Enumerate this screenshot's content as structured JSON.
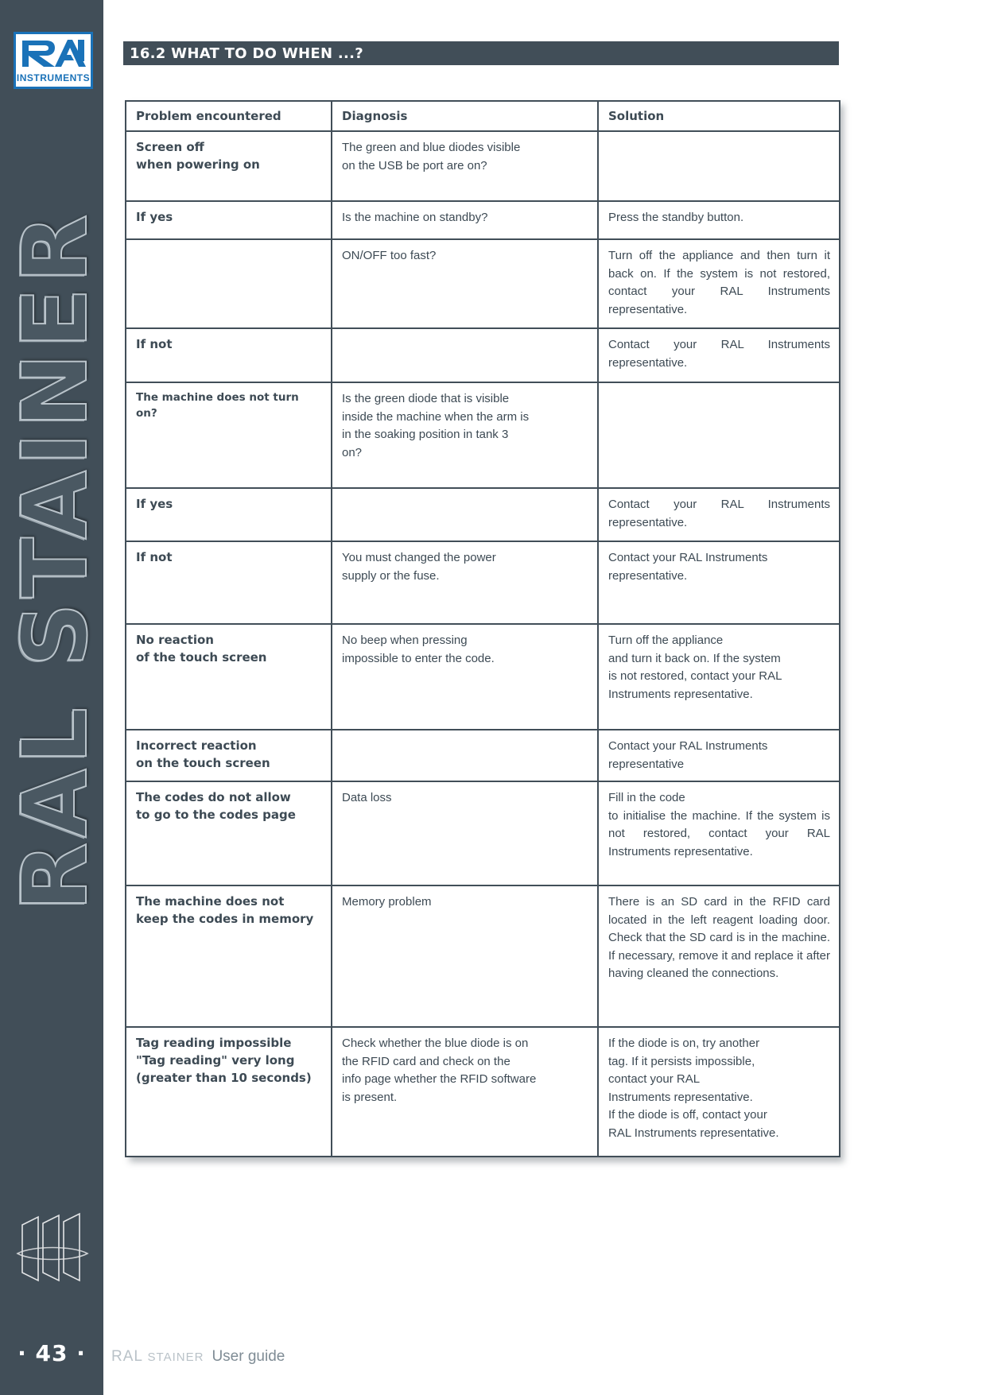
{
  "sidebar": {
    "logo": {
      "mark": "RAL",
      "wordmark": "INSTRUMENTS"
    },
    "vertical_title": "RAL STAINER",
    "emblem_name": "sail-fin-emblem",
    "page_number": "· 43 ·"
  },
  "section": {
    "heading": "16.2 WHAT TO DO WHEN ...?"
  },
  "table": {
    "headers": [
      "Problem encountered",
      "Diagnosis",
      "Solution"
    ],
    "rows": [
      {
        "problem": [
          "Screen off",
          "when powering on"
        ],
        "diagnosis": [
          "The green and blue diodes visible",
          "on the USB be port are on?"
        ],
        "solution": []
      },
      {
        "problem": [
          "If yes"
        ],
        "diagnosis": [
          "Is the machine on standby?"
        ],
        "solution": [
          "Press the standby button."
        ]
      },
      {
        "problem": [],
        "diagnosis": [
          "ON/OFF too fast?"
        ],
        "solution": [
          "Turn off the appliance and then turn it back on. If the system is not restored, contact your RAL Instruments representative."
        ]
      },
      {
        "problem": [
          "If not"
        ],
        "diagnosis": [],
        "solution": [
          "Contact your RAL Instruments representative."
        ]
      },
      {
        "problem": [
          "The machine does not turn on?"
        ],
        "diagnosis": [
          "Is the green diode that is visible",
          "inside the machine when the arm is",
          "in the soaking position in tank 3",
          "on?"
        ],
        "solution": []
      },
      {
        "problem": [
          "If yes"
        ],
        "diagnosis": [],
        "solution": [
          "Contact your RAL Instruments representative."
        ]
      },
      {
        "problem": [
          "If not"
        ],
        "diagnosis": [
          "You must changed the power",
          "supply or the fuse."
        ],
        "solution": [
          "Contact your RAL Instruments",
          "representative."
        ]
      },
      {
        "problem": [
          "No reaction",
          "of the touch screen"
        ],
        "diagnosis": [
          "No beep when pressing",
          "impossible to enter the code."
        ],
        "solution": [
          "Turn off the appliance",
          "and turn it back on. If the system",
          "is not restored, contact your RAL",
          "Instruments representative."
        ]
      },
      {
        "problem": [
          "Incorrect reaction",
          "on the touch screen"
        ],
        "diagnosis": [],
        "solution": [
          "Contact your RAL Instruments",
          "representative"
        ]
      },
      {
        "problem": [
          "The codes do not allow",
          "to go to the codes page"
        ],
        "diagnosis": [
          "Data loss"
        ],
        "solution": [
          "Fill in the code",
          "to initialise the machine. If the system is not restored, contact your RAL Instruments representative."
        ]
      },
      {
        "problem": [
          "The machine does not",
          "keep the codes in memory"
        ],
        "diagnosis": [
          "Memory problem"
        ],
        "solution": [
          "There is an SD card in the RFID card located in the left reagent loading door. Check that the SD card is in the machine. If necessary, remove it and replace it after having cleaned the connections."
        ]
      },
      {
        "problem": [
          "Tag reading impossible",
          "\"Tag reading\" very long",
          "(greater than 10 seconds)"
        ],
        "diagnosis": [
          " Check whether the blue diode is on",
          " the RFID card and check on the",
          "info page whether the RFID software",
          " is present."
        ],
        "solution": [
          "If the diode is on, try another",
          "tag. If it persists impossible,",
          " contact your RAL",
          "Instruments representative.",
          "If the diode is off, contact your",
          "RAL Instruments representative."
        ]
      }
    ]
  },
  "footer": {
    "brand_primary": "RAL",
    "brand_secondary": "STAINER",
    "guide_label": "User guide"
  },
  "colors": {
    "dark": "#414e58",
    "logo_blue": "#1a72b8",
    "text": "#3d4a54"
  }
}
